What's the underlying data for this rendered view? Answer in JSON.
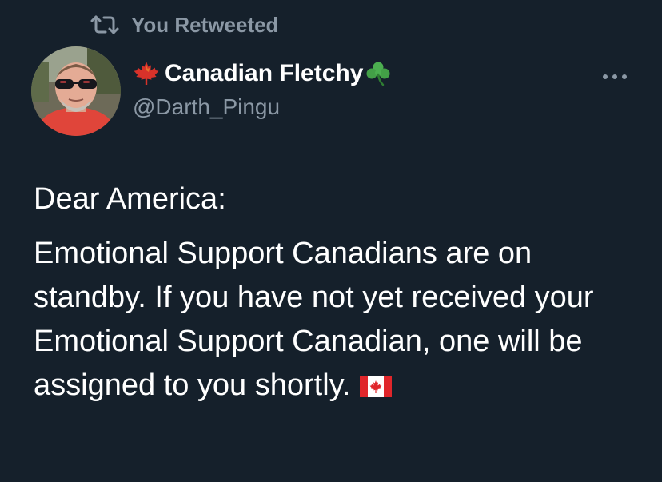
{
  "retweet": {
    "label": "You Retweeted",
    "icon": "retweet-icon"
  },
  "author": {
    "display_name": "Canadian Fletchy",
    "prefix_icon": "maple-leaf-icon",
    "suffix_icon": "shamrock-icon",
    "handle": "@Darth_Pingu",
    "avatar_icon": "avatar"
  },
  "more_icon": "more-options-icon",
  "tweet": {
    "greeting": "Dear America:",
    "body": "Emotional Support Canadians are on standby. If you have not yet received your Emotional Support Canadian, one will be assigned to you shortly.",
    "trailing_icon": "canada-flag-icon"
  },
  "colors": {
    "background": "#15202b",
    "primary_text": "#ffffff",
    "secondary_text": "#8b98a5",
    "flag_red": "#e0262b",
    "maple_red": "#d8322a",
    "clover_green": "#4caf50"
  }
}
